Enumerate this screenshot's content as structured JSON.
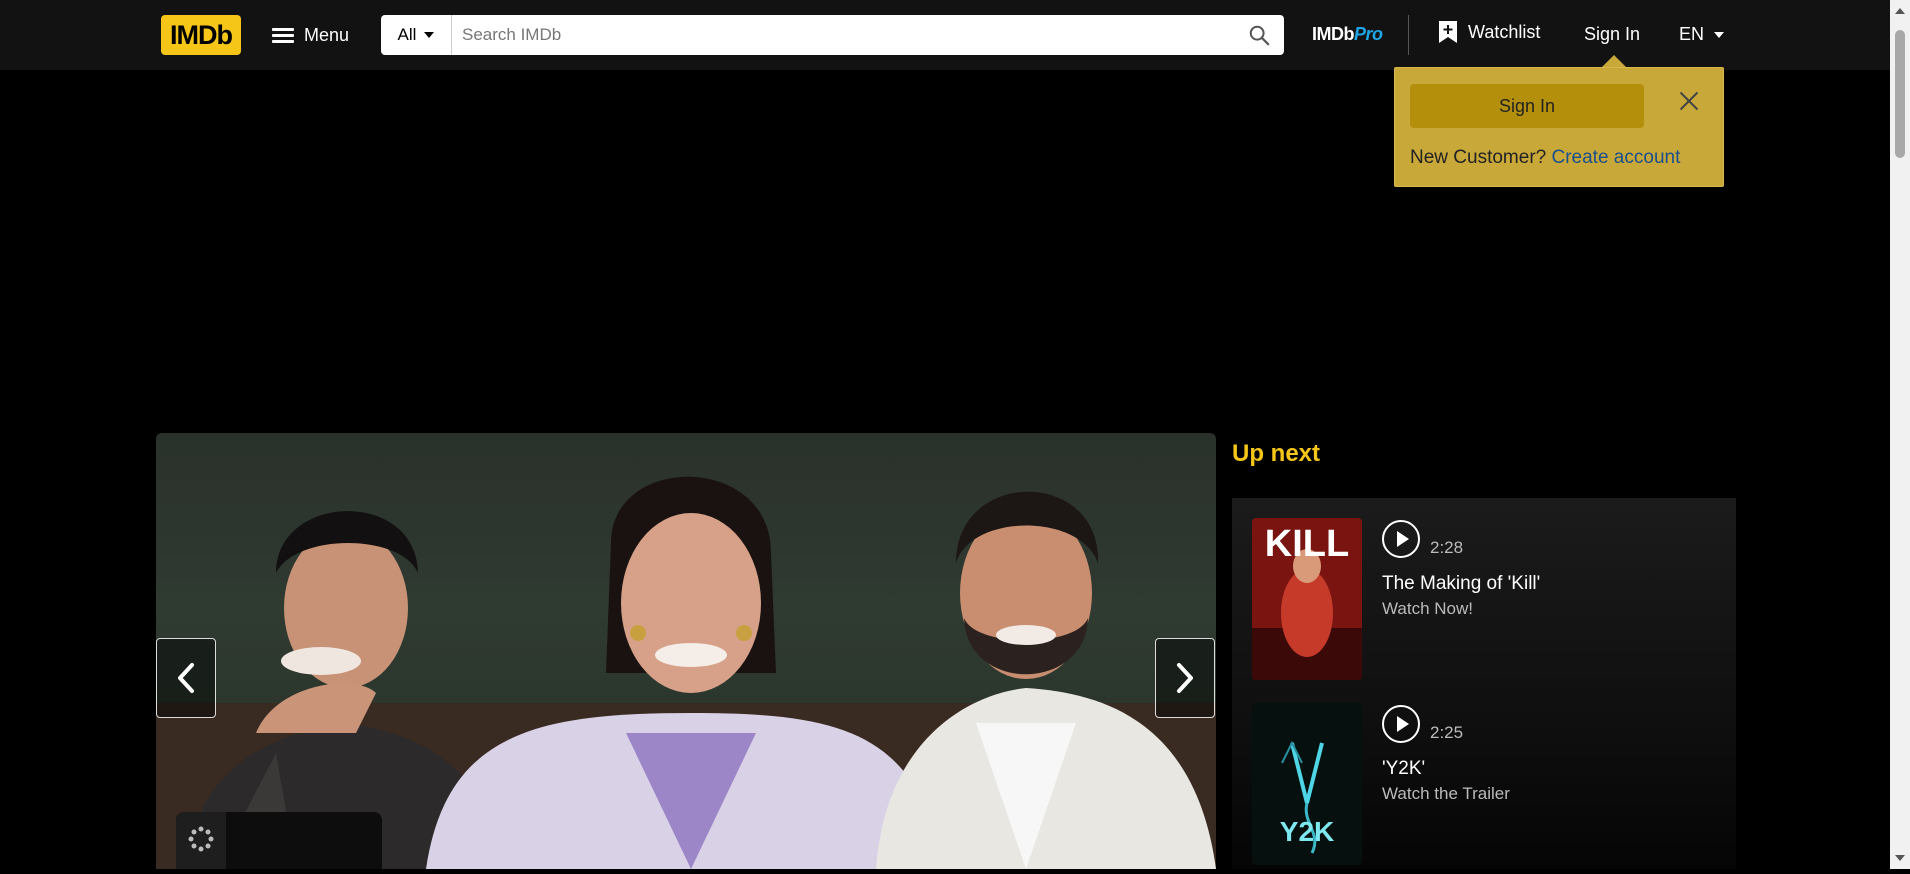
{
  "header": {
    "logo_text": "IMDb",
    "menu_label": "Menu",
    "search_category": "All",
    "search_placeholder": "Search IMDb",
    "imdbpro_left": "IMDb",
    "imdbpro_right": "Pro",
    "watchlist_label": "Watchlist",
    "signin_label": "Sign In",
    "language": "EN"
  },
  "signin_popover": {
    "button_label": "Sign In",
    "prompt": "New Customer?",
    "create_link": "Create account"
  },
  "up_next": {
    "title": "Up next",
    "items": [
      {
        "duration": "2:28",
        "title": "The Making of 'Kill'",
        "subtitle": "Watch Now!",
        "poster_text": "KILL"
      },
      {
        "duration": "2:25",
        "title": "'Y2K'",
        "subtitle": "Watch the Trailer",
        "poster_text": "Y2K"
      }
    ]
  },
  "colors": {
    "accent": "#f5c518",
    "topbar_bg": "#121212",
    "page_bg": "#000000",
    "link": "#1b4f8a",
    "pro_blue": "#1ea7e4"
  },
  "icons": [
    "hamburger-icon",
    "chevron-down-icon",
    "search-icon",
    "watchlist-plus-icon",
    "close-icon",
    "chevron-left-icon",
    "chevron-right-icon",
    "play-icon",
    "loading-spinner-icon"
  ]
}
